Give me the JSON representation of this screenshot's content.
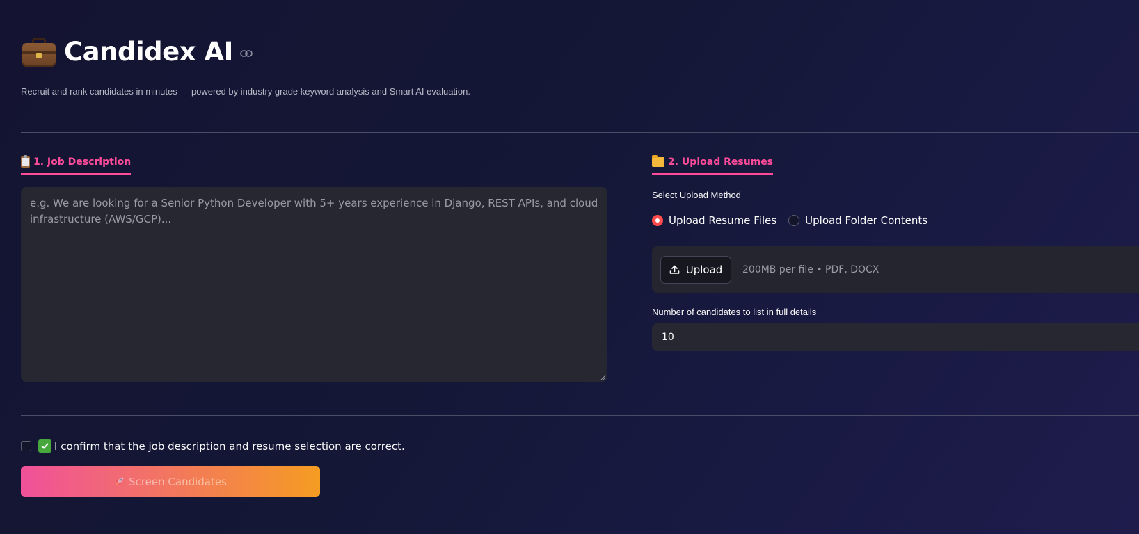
{
  "app": {
    "title": "Candidex AI",
    "subtitle": "Recruit and rank candidates in minutes — powered by industry grade keyword analysis and Smart AI evaluation.",
    "logo_icon": "briefcase-icon",
    "anchor_icon": "link-icon"
  },
  "job_description": {
    "heading": "1. Job Description",
    "heading_icon": "clipboard-icon",
    "placeholder": "e.g. We are looking for a Senior Python Developer with 5+ years experience in Django, REST APIs, and cloud infrastructure (AWS/GCP)...",
    "value": ""
  },
  "upload_resumes": {
    "heading": "2. Upload Resumes",
    "heading_icon": "folder-icon",
    "method_label": "Select Upload Method",
    "methods": [
      {
        "label": "Upload Resume Files",
        "selected": true
      },
      {
        "label": "Upload Folder Contents",
        "selected": false
      }
    ],
    "upload_button": "Upload",
    "upload_hint": "200MB per file • PDF, DOCX",
    "candidates_label": "Number of candidates to list in full details",
    "candidates_value": "10"
  },
  "confirm": {
    "label": "I confirm that the job description and resume selection are correct.",
    "checked": false,
    "icon": "check-mark-button-icon"
  },
  "action": {
    "screen_label": "Screen Candidates",
    "icon": "rocket-icon",
    "enabled": false
  },
  "colors": {
    "accent_pink": "#ff4b9a",
    "radio_active": "#ff4b4b",
    "button_gradient_start": "#f0519a",
    "button_gradient_end": "#f59c22"
  }
}
